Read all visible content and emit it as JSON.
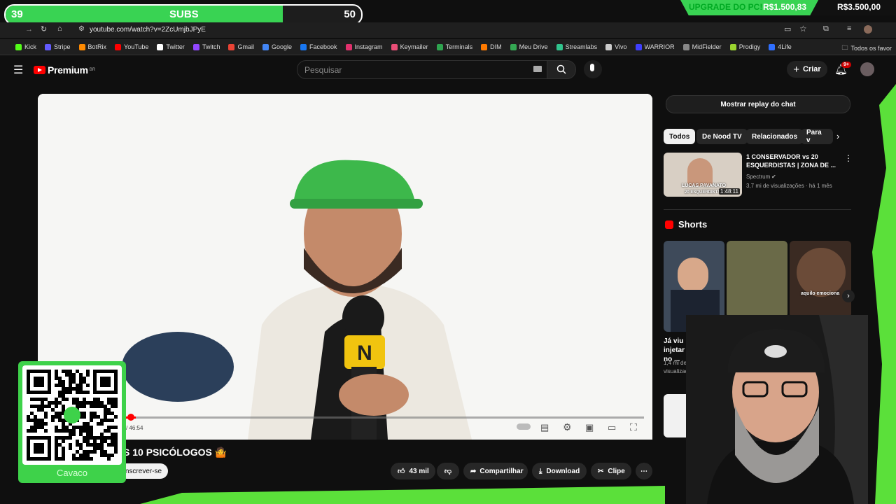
{
  "overlay": {
    "subs_left": "39",
    "subs_label": "SUBS",
    "subs_right": "50",
    "subs_progress": 0.78,
    "upgrade_label": "UPGRADE DO PC!",
    "upgrade_current": "R$1.500,83",
    "upgrade_goal": "R$3.500,00",
    "qr_name": "Cavaco"
  },
  "browser": {
    "url": "youtube.com/watch?v=2ZcUmjbJPyE",
    "bookmarks": [
      "Kick",
      "Stripe",
      "BotRix",
      "YouTube",
      "Twitter",
      "Twitch",
      "Gmail",
      "Google",
      "Facebook",
      "Instagram",
      "Keymailer",
      "Terminals",
      "DIM",
      "Meu Drive",
      "Streamlabs",
      "Vivo",
      "WARRIOR",
      "MidFielder",
      "Prodigy",
      "4Life"
    ],
    "bookmarks_folder": "Todos os favor"
  },
  "header": {
    "logo_text": "Premium",
    "logo_region": "BR",
    "search_placeholder": "Pesquisar",
    "create_label": "Criar",
    "notif_count": "9+"
  },
  "video": {
    "time": "/ 46:54",
    "title_partial": "S 10 PSICÓLOGOS 🤷",
    "subscribe_label": "nscrever-se",
    "likes": "43 mil",
    "share_label": "Compartilhar",
    "download_label": "Download",
    "clip_label": "Clipe"
  },
  "sidebar": {
    "chat_replay": "Mostrar replay do chat",
    "chips": [
      "Todos",
      "De Nood TV",
      "Relacionados",
      "Para v"
    ],
    "rec": {
      "title": "1 CONSERVADOR vs 20 ESQUERDISTAS | ZONA DE ...",
      "channel": "Spectrum",
      "meta": "3,7 mi de visualizações · há 1 mês",
      "duration": "1:48:11",
      "thumb_caption": "LUCAS PAVANATO",
      "thumb_caption2": "20 ESQUERDISTAS"
    },
    "shorts_heading": "Shorts",
    "short1_title": "Já viu injetar Nitro no ...",
    "short1_meta": "1,4 mi de",
    "short1_meta2": "visualizaç",
    "short3_caption": "aquilo emociona"
  }
}
